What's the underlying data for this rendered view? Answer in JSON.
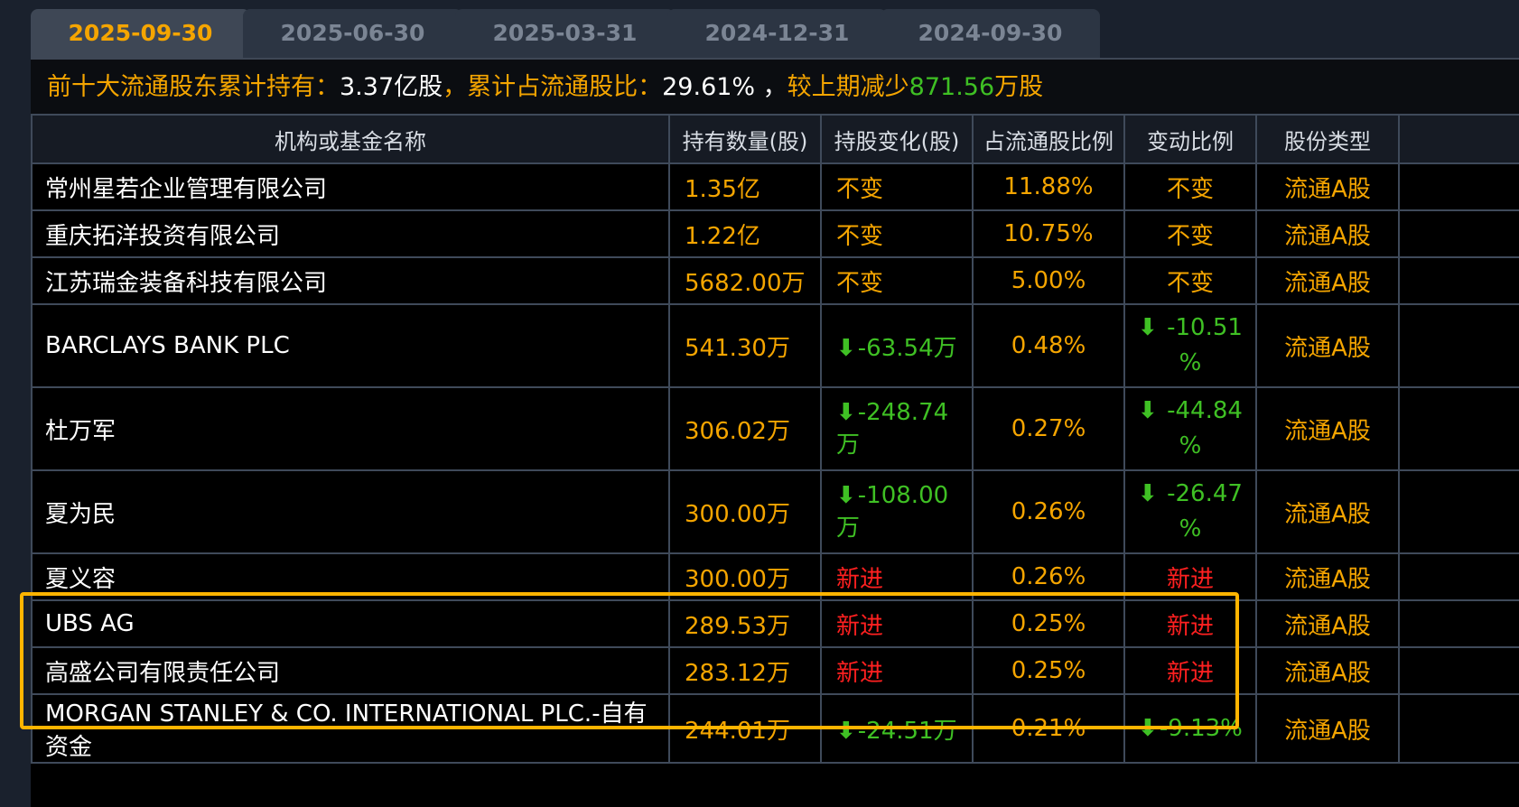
{
  "tabs": [
    {
      "label": "2025-09-30",
      "active": true
    },
    {
      "label": "2025-06-30",
      "active": false
    },
    {
      "label": "2025-03-31",
      "active": false
    },
    {
      "label": "2024-12-31",
      "active": false
    },
    {
      "label": "2024-09-30",
      "active": false
    }
  ],
  "summary": {
    "prefix": "前十大流通股东累计持有：",
    "holding": "3.37亿股",
    "mid": "，累计占流通股比：",
    "ratio": "29.61%",
    "sep": " ，",
    "change_label": "较上期减少",
    "change_value": "871.56",
    "change_unit": "万股"
  },
  "columns": [
    "机构或基金名称",
    "持有数量(股)",
    "持股变化(股)",
    "占流通股比例",
    "变动比例",
    "股份类型"
  ],
  "rows": [
    {
      "name": "常州星若企业管理有限公司",
      "qty": "1.35亿",
      "change": "不变",
      "change_type": "flat",
      "ratio": "11.88%",
      "pct": "不变",
      "pct_type": "flat",
      "pct_line2": "",
      "type": "流通A股"
    },
    {
      "name": "重庆拓洋投资有限公司",
      "qty": "1.22亿",
      "change": "不变",
      "change_type": "flat",
      "ratio": "10.75%",
      "pct": "不变",
      "pct_type": "flat",
      "pct_line2": "",
      "type": "流通A股"
    },
    {
      "name": "江苏瑞金装备科技有限公司",
      "qty": "5682.00万",
      "change": "不变",
      "change_type": "flat",
      "ratio": "5.00%",
      "pct": "不变",
      "pct_type": "flat",
      "pct_line2": "",
      "type": "流通A股"
    },
    {
      "name": "BARCLAYS BANK PLC",
      "qty": "541.30万",
      "change": "-63.54万",
      "change_type": "down",
      "ratio": "0.48%",
      "pct": "-10.51",
      "pct_type": "down",
      "pct_line2": "%",
      "type": "流通A股"
    },
    {
      "name": "杜万军",
      "qty": "306.02万",
      "change": "-248.74万",
      "change_type": "down",
      "ratio": "0.27%",
      "pct": "-44.84",
      "pct_type": "down",
      "pct_line2": "%",
      "type": "流通A股"
    },
    {
      "name": "夏为民",
      "qty": "300.00万",
      "change": "-108.00万",
      "change_type": "down",
      "ratio": "0.26%",
      "pct": "-26.47",
      "pct_type": "down",
      "pct_line2": "%",
      "type": "流通A股"
    },
    {
      "name": "夏义容",
      "qty": "300.00万",
      "change": "新进",
      "change_type": "new",
      "ratio": "0.26%",
      "pct": "新进",
      "pct_type": "new",
      "pct_line2": "",
      "type": "流通A股"
    },
    {
      "name": "UBS AG",
      "qty": "289.53万",
      "change": "新进",
      "change_type": "new",
      "ratio": "0.25%",
      "pct": "新进",
      "pct_type": "new",
      "pct_line2": "",
      "type": "流通A股"
    },
    {
      "name": "高盛公司有限责任公司",
      "qty": "283.12万",
      "change": "新进",
      "change_type": "new",
      "ratio": "0.25%",
      "pct": "新进",
      "pct_type": "new",
      "pct_line2": "",
      "type": "流通A股"
    },
    {
      "name": "MORGAN STANLEY & CO. INTERNATIONAL PLC.-自有资金",
      "qty": "244.01万",
      "change": "-24.51万",
      "change_type": "down",
      "ratio": "0.21%",
      "pct": "-9.13%",
      "pct_type": "down",
      "pct_line2": "",
      "type": "流通A股"
    }
  ],
  "icons": {
    "down_arrow": "arrow-down-icon"
  },
  "colors": {
    "accent": "#f5a500",
    "up_new": "#ff2020",
    "down": "#3fc024",
    "highlight": "#ffb400",
    "background": "#000000"
  }
}
